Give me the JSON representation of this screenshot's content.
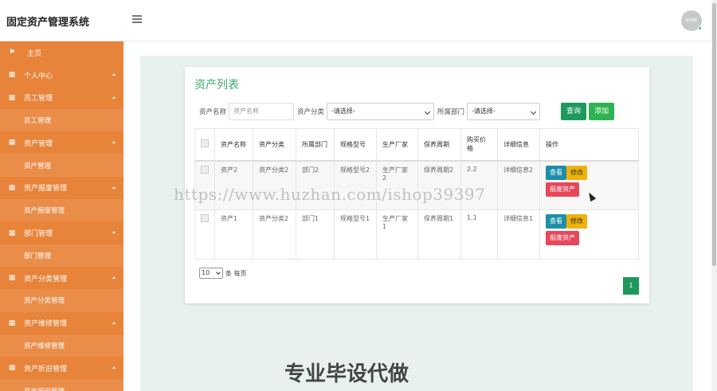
{
  "header": {
    "title": "固定资产管理系统",
    "menu_icon": "hamburger-icon",
    "avatar_text": "NAME"
  },
  "sidebar": {
    "items": [
      {
        "type": "home",
        "label": "主页",
        "icon": "flag-icon"
      },
      {
        "type": "main",
        "label": "个人中心",
        "icon": "grid-icon"
      },
      {
        "type": "main",
        "label": "员工管理",
        "icon": "grid-icon"
      },
      {
        "type": "sub",
        "label": "员工管理"
      },
      {
        "type": "main",
        "label": "资产管理",
        "icon": "grid-icon"
      },
      {
        "type": "sub",
        "label": "资产管理"
      },
      {
        "type": "main",
        "label": "资产报废管理",
        "icon": "grid-icon"
      },
      {
        "type": "sub",
        "label": "资产报废管理"
      },
      {
        "type": "main",
        "label": "部门管理",
        "icon": "grid-icon"
      },
      {
        "type": "sub",
        "label": "部门管理"
      },
      {
        "type": "main",
        "label": "资产分类管理",
        "icon": "grid-icon"
      },
      {
        "type": "sub",
        "label": "资产分类管理"
      },
      {
        "type": "main",
        "label": "资产维修管理",
        "icon": "grid-icon"
      },
      {
        "type": "sub",
        "label": "资产维修管理"
      },
      {
        "type": "main",
        "label": "资产折旧管理",
        "icon": "grid-icon"
      },
      {
        "type": "sub",
        "label": "资产折旧管理"
      }
    ]
  },
  "main": {
    "card_title": "资产列表",
    "filter": {
      "name_label": "资产名称",
      "name_placeholder": "资产名称",
      "category_label": "资产分类",
      "category_value": "-请选择-",
      "dept_label": "所属部门",
      "dept_value": "-请选择-",
      "search_button": "查询",
      "add_button": "添加"
    },
    "table": {
      "headers": [
        "资产名称",
        "资产分类",
        "所属部门",
        "规格型号",
        "生产厂家",
        "保养周期",
        "购买价格",
        "详细信息",
        "操作"
      ],
      "rows": [
        {
          "name": "资产2",
          "category": "资产分类2",
          "dept": "部门2",
          "model": "规格型号2",
          "maker": "生产厂家2",
          "cycle": "保养周期2",
          "price": "2.2",
          "detail": "详细信息2"
        },
        {
          "name": "资产1",
          "category": "资产分类2",
          "dept": "部门1",
          "model": "规格型号1",
          "maker": "生产厂家1",
          "cycle": "保养周期1",
          "price": "1.1",
          "detail": "详细信息1"
        }
      ],
      "view_button": "查看",
      "edit_button": "修改",
      "scrap_button": "报废资产"
    },
    "pagination": {
      "page_size": "10",
      "page_size_suffix": "条 每页",
      "current_page": "1"
    }
  },
  "overlay": {
    "watermark": "https://www.huzhan.com/ishop39397",
    "bottom_ad": "专业毕设代做"
  },
  "colors": {
    "sidebar": "#e8833a",
    "accent_green": "#1e9a5c",
    "title_green": "#3ea86b"
  }
}
